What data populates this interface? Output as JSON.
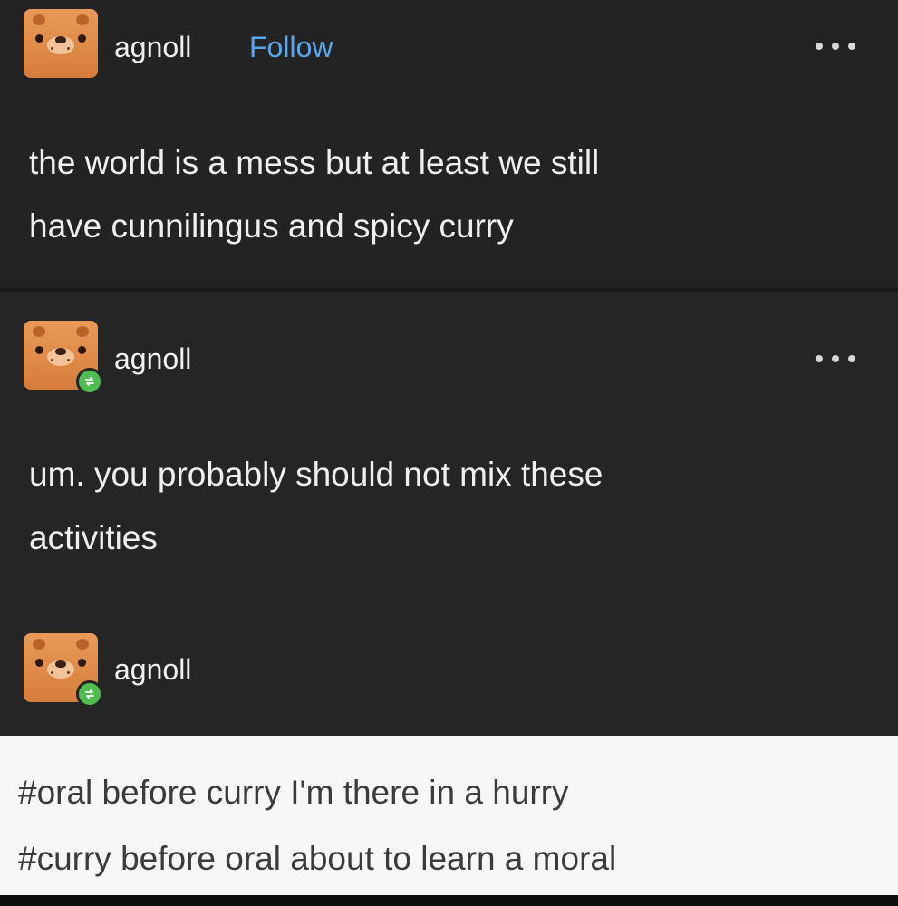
{
  "posts": [
    {
      "username": "agnoll",
      "follow_label": "Follow",
      "more_icon": "more-dots-icon",
      "text_lines": [
        "the world is a mess but at least we still",
        "have cunnilingus and spicy curry"
      ]
    },
    {
      "username": "agnoll",
      "reblog_icon": "reblog-icon",
      "more_icon": "more-dots-icon",
      "text_lines": [
        "um. you probably should not mix these",
        "activities"
      ]
    },
    {
      "username": "agnoll",
      "reblog_icon": "reblog-icon"
    }
  ],
  "tags": [
    "#oral before curry I'm there in a hurry",
    "#curry before oral about to learn a moral"
  ],
  "colors": {
    "background": "#222222",
    "text": "#efefef",
    "follow": "#58a6ee",
    "avatar": "#e08a47",
    "reblog_badge": "#4fbd52",
    "tags_background": "#f7f7f7",
    "tag_text": "#3b3b3b"
  }
}
